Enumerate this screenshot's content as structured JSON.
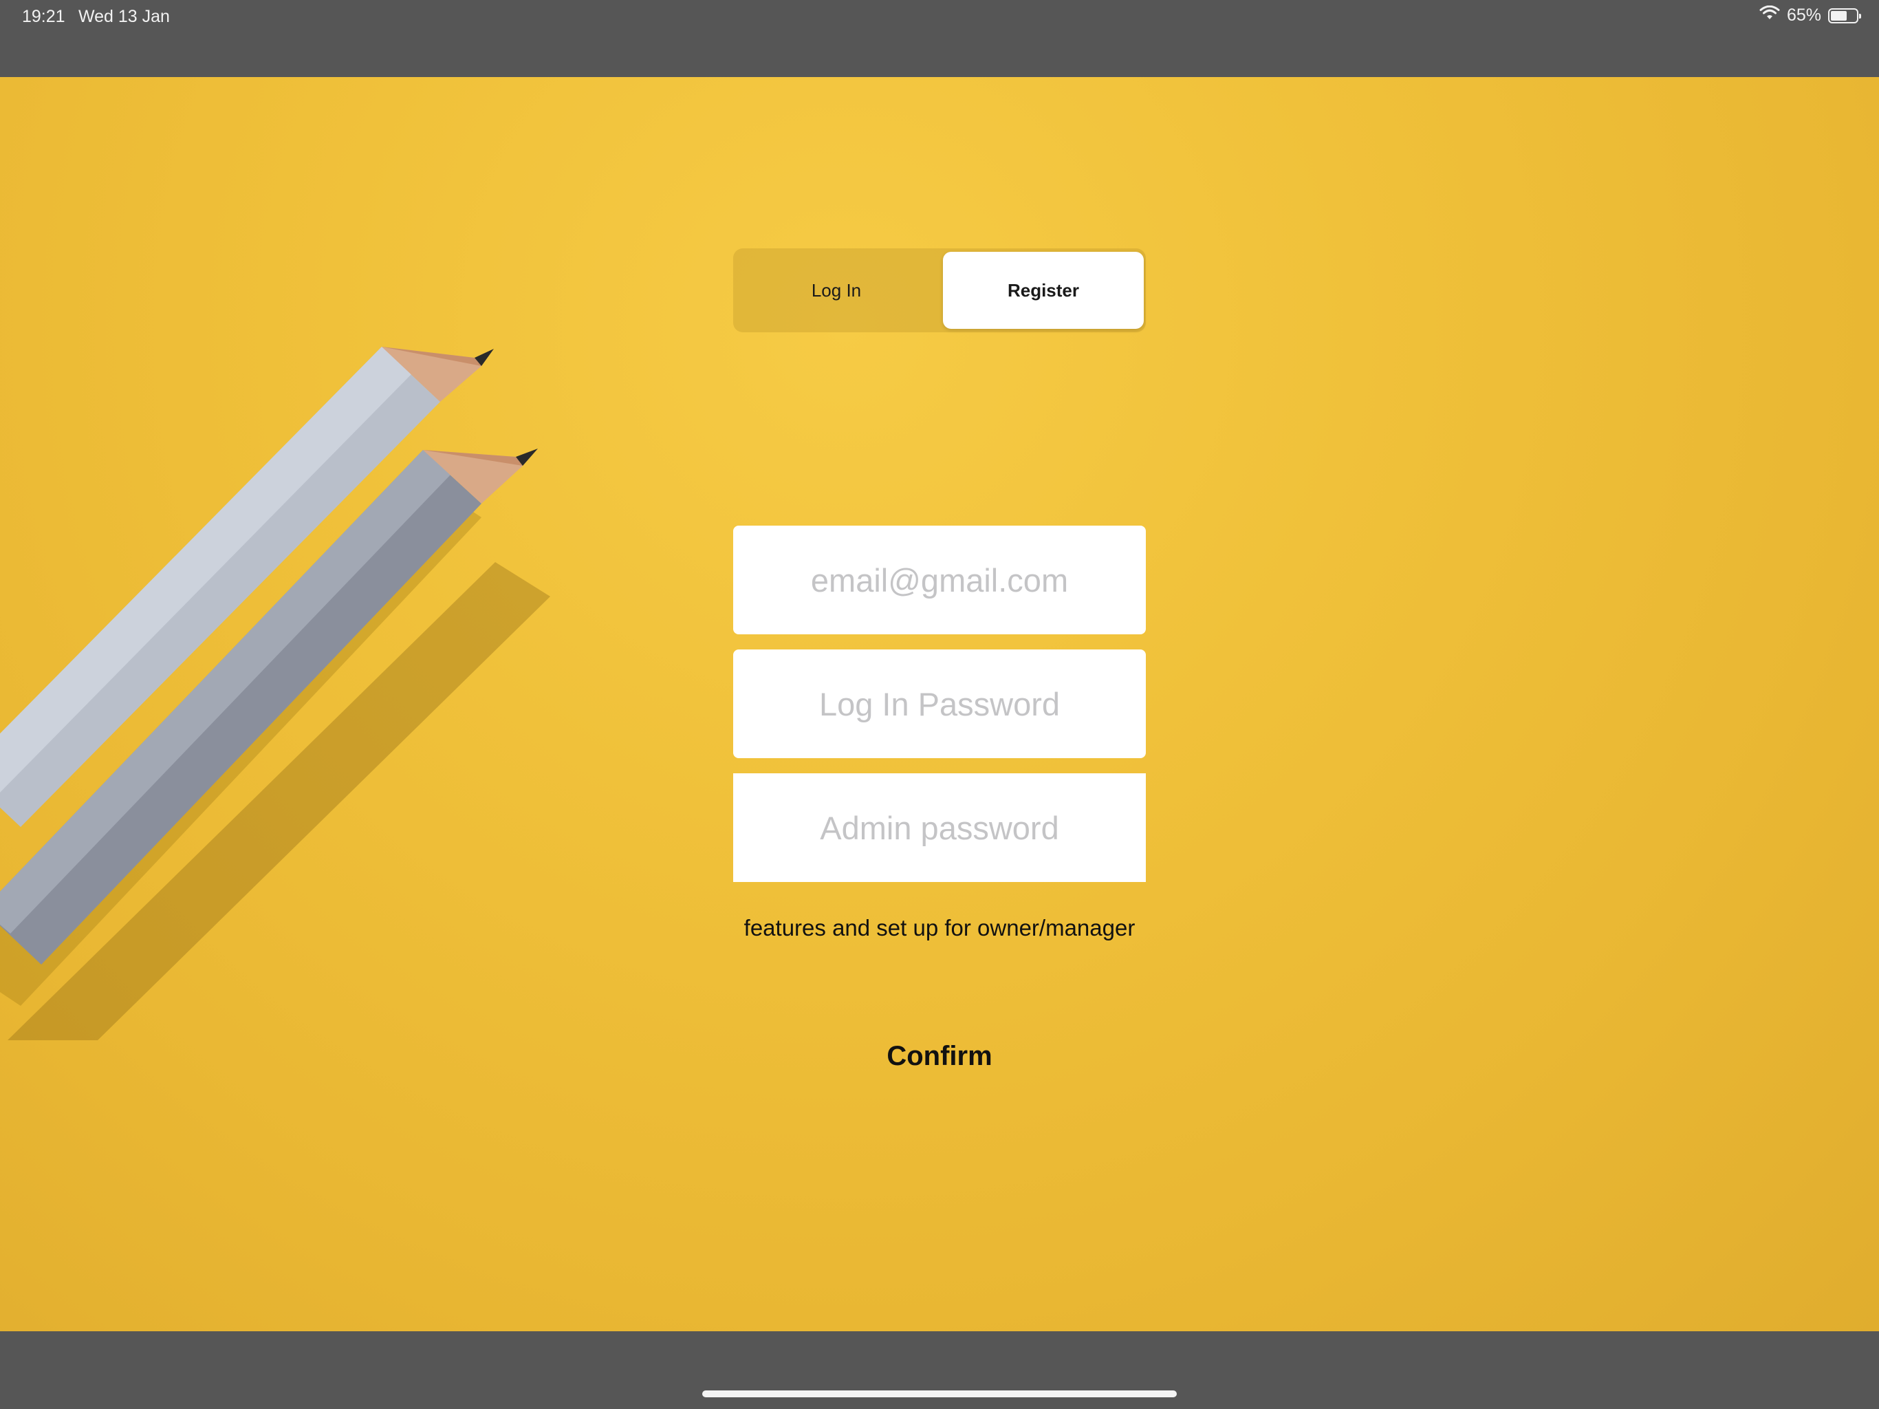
{
  "status_bar": {
    "time": "19:21",
    "date": "Wed 13 Jan",
    "battery_percent": "65%",
    "battery_level": 0.65,
    "wifi_icon": "wifi-icon",
    "battery_icon": "battery-icon"
  },
  "segmented_control": {
    "options": [
      "Log In",
      "Register"
    ],
    "selected": "Register"
  },
  "form": {
    "email_placeholder": "email@gmail.com",
    "password_placeholder": "Log In Password",
    "admin_placeholder": "Admin password",
    "caption": "features and set up for owner/manager",
    "confirm_label": "Confirm"
  },
  "background": {
    "image": "yellow paper with two grey pencils",
    "accent": "#F0C13A"
  }
}
